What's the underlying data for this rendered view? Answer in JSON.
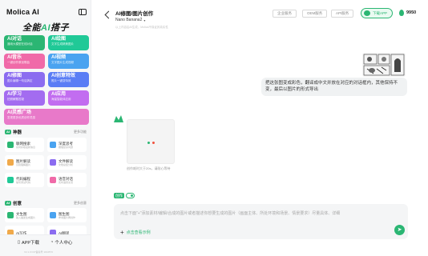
{
  "app": {
    "logo": "Molica AI",
    "slogan_pre": "全能",
    "slogan_ai": "AI",
    "slogan_post": "搭子"
  },
  "sidebar": {
    "feature_cards": [
      {
        "title": "AI对话",
        "sub": "通用大模型在线对话",
        "color": "#2bb673"
      },
      {
        "title": "AI绘图",
        "sub": "文字生成精美图片",
        "color": "#20c997"
      },
      {
        "title": "AI音乐",
        "sub": "一键创作原创歌曲",
        "color": "#f06aa8"
      },
      {
        "title": "AI视频",
        "sub": "文字图片生成视频",
        "color": "#4aa3f0"
      },
      {
        "title": "AI修图",
        "sub": "图片编辑一句话搞定",
        "color": "#8b6cf0"
      },
      {
        "title": "AI创意特效",
        "sub": "照片一键变特效",
        "color": "#5a7df5"
      },
      {
        "title": "AI学习",
        "sub": "拍照解题答疑",
        "color": "#a36cf0"
      },
      {
        "title": "AI应用",
        "sub": "海量智能体应用",
        "color": "#c26df0"
      },
      {
        "title": "AI灵感广场",
        "sub": "发现更多优质创作灵感",
        "color": "#e879c9"
      }
    ],
    "section1": {
      "label": "AI",
      "suffix": "神器",
      "more": "更多功能"
    },
    "tools": [
      {
        "title": "联网搜索",
        "sub": "实时获取最新信息",
        "color": "#2bb673"
      },
      {
        "title": "深度思考",
        "sub": "推理复杂问题",
        "color": "#4aa3f0"
      },
      {
        "title": "图片解读",
        "sub": "识别理解图片",
        "color": "#f0a94a"
      },
      {
        "title": "文件解读",
        "sub": "文档总结分析",
        "color": "#8b6cf0"
      },
      {
        "title": "代码编程",
        "sub": "编写调试代码",
        "color": "#20c997"
      },
      {
        "title": "语音对话",
        "sub": "实时语音交流",
        "color": "#f06aa8"
      }
    ],
    "section2": {
      "label": "AI",
      "suffix": "创意",
      "more": "更多创意"
    },
    "tools2": [
      {
        "title": "文生图",
        "sub": "输入描述生成图片",
        "color": "#2bb673"
      },
      {
        "title": "图生图",
        "sub": "参考图片再创作",
        "color": "#4aa3f0"
      },
      {
        "title": "AI写作",
        "sub": "",
        "color": "#f0a94a"
      },
      {
        "title": "AI翻译",
        "sub": "",
        "color": "#8b6cf0"
      }
    ],
    "bottom": {
      "download": "APP下载",
      "profile": "个人中心",
      "version": "V2.1.0 ICP备案号 1194573"
    }
  },
  "header": {
    "title": "AI修图/图片创作",
    "model": "Nano Banana2",
    "sub_note": "以上内容由AI生成，Molica不保证其真实性",
    "buttons": [
      "企业服务",
      "OEM服务",
      "API服务"
    ],
    "download_app": "下载APP",
    "points": "9950"
  },
  "chat": {
    "user_message": "把这张图变成彩色，翻译成中文并放在对应的对话框内，其他保持不变，最后以图片的形式导出",
    "generating_note": "创作耗时大于20s，请耐心等待",
    "colors": {
      "dot_green": "#2bb673",
      "dot_red": "#f0503c"
    }
  },
  "composer": {
    "toggle_label": "创作",
    "placeholder": "点击下面\"+\"添加素材/编辑/合成的图片或者描述你想要生成的图片（画面主体、所处环境和场景、情景要求）尽量具体、详细",
    "examples": "点击查看示例",
    "send_icon": "send-icon"
  },
  "theme": {
    "accent": "#2bb673"
  }
}
